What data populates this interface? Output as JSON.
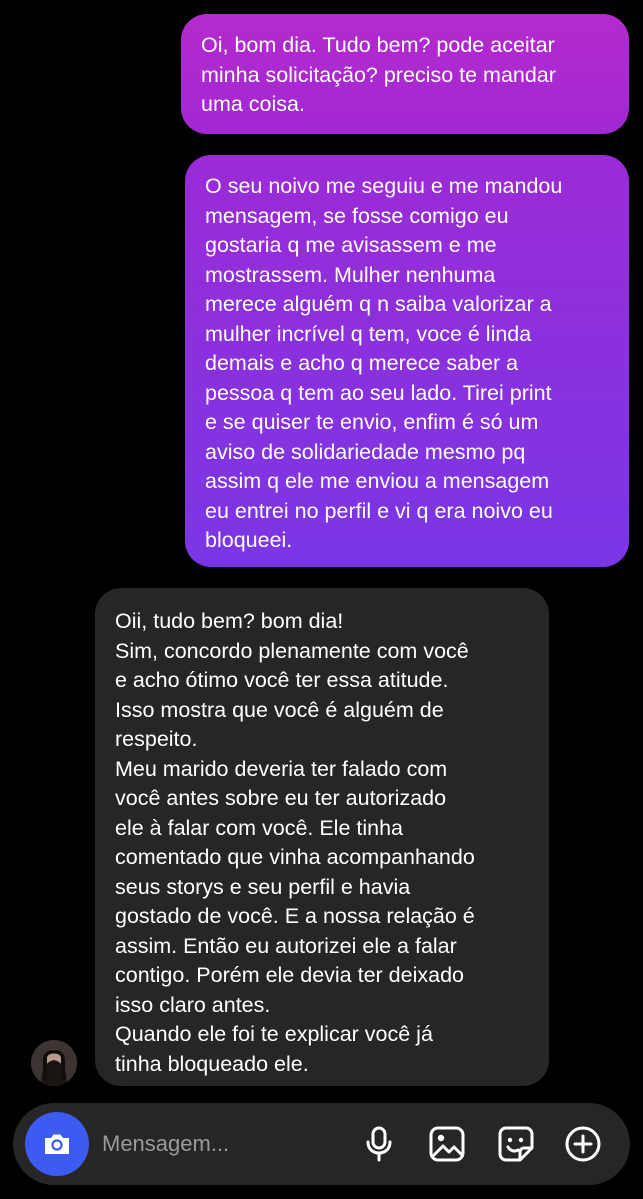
{
  "messages": [
    {
      "direction": "outgoing",
      "text": "Oi, bom dia. Tudo bem? pode aceitar\nminha solicitação? preciso te mandar\numa coisa."
    },
    {
      "direction": "outgoing",
      "text": "O seu noivo me seguiu e me mandou\nmensagem, se fosse comigo eu\ngostaria q me avisassem e me\nmostrassem. Mulher nenhuma\nmerece alguém q n saiba valorizar a\nmulher incrível q tem, voce é linda\ndemais e acho q merece saber a\npessoa q tem ao seu lado. Tirei print\ne se quiser te envio, enfim é só um\naviso de solidariedade mesmo pq\nassim q ele me enviou a mensagem\neu entrei no perfil e vi q era noivo eu\nbloqueei."
    },
    {
      "direction": "incoming",
      "text": "Oii, tudo bem? bom dia!\nSim, concordo plenamente com você\ne acho ótimo você  ter essa atitude.\nIsso mostra que você é alguém de\nrespeito.\nMeu marido deveria ter falado com\nvocê antes sobre eu ter autorizado\nele à falar com você. Ele tinha\ncomentado que vinha acompanhando\nseus storys e seu perfil e havia\ngostado de você. E a nossa relação é\nassim. Então eu autorizei ele a falar\ncontigo.  Porém ele devia ter deixado\nisso claro antes.\nQuando ele foi te explicar você já\ntinha bloqueado ele."
    }
  ],
  "composer": {
    "placeholder": "Mensagem...",
    "camera_icon": "camera-icon",
    "icons": [
      "microphone-icon",
      "gallery-icon",
      "sticker-icon",
      "add-circle-icon"
    ]
  },
  "colors": {
    "background": "#000000",
    "outgoing_top": "#b42bcc",
    "outgoing_bottom": "#7a36e6",
    "incoming_bubble": "#262626",
    "camera_button": "#3d5af1",
    "placeholder_text": "#9a9a9a"
  }
}
